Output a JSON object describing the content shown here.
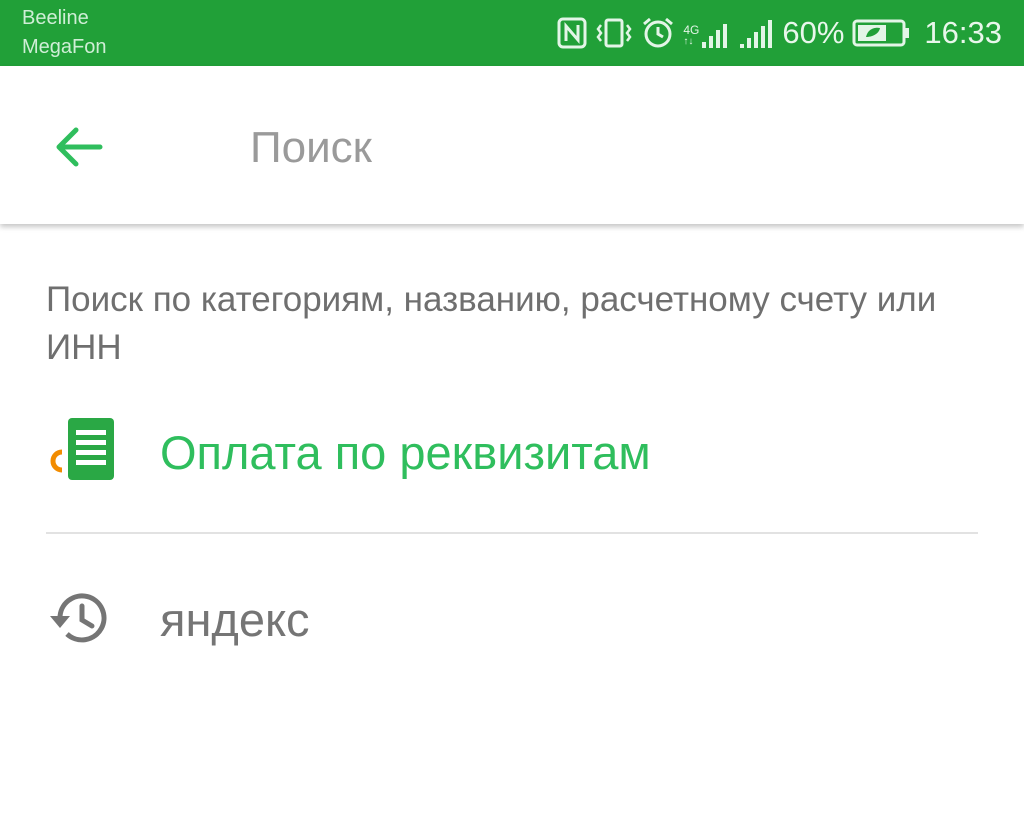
{
  "status_bar": {
    "carriers": [
      "Beeline",
      "MegaFon"
    ],
    "battery_percent": "60%",
    "time": "16:33",
    "network_type": "4G",
    "icons": [
      "nfc-icon",
      "vibrate-icon",
      "alarm-icon",
      "signal-4g-icon",
      "signal-icon",
      "battery-icon"
    ]
  },
  "header": {
    "back_icon": "arrow-left-icon",
    "search_placeholder": "Поиск",
    "search_value": ""
  },
  "main": {
    "hint": "Поиск по категориям, названию, расчетному счету или ИНН",
    "items": [
      {
        "label": "Оплата по реквизитам",
        "icon": "document-payment-icon"
      },
      {
        "label": "яндекс",
        "icon": "history-icon"
      }
    ]
  },
  "colors": {
    "status_bar": "#21a038",
    "accent": "#2fbe5d",
    "icon_orange": "#f28c00",
    "icon_green": "#2aa845",
    "text_secondary": "#6f6f6f"
  }
}
